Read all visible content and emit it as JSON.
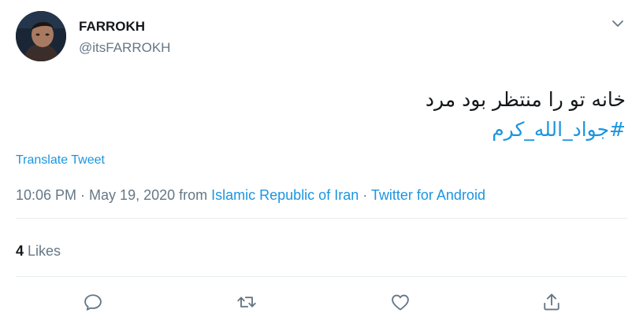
{
  "user": {
    "display_name": "FARROKH",
    "handle": "@itsFARROKH"
  },
  "tweet": {
    "text_line1": "خانه تو را منتظر بود مرد",
    "hashtag": "#جواد_الله_کرم",
    "translate_label": "Translate Tweet"
  },
  "meta": {
    "time": "10:06 PM",
    "sep1": " · ",
    "date": "May 19, 2020",
    "from_word": " from ",
    "location": "Islamic Republic of Iran",
    "sep2": " · ",
    "source": "Twitter for Android"
  },
  "stats": {
    "likes_count": "4",
    "likes_label": "Likes"
  },
  "colors": {
    "accent": "#1b95e0",
    "secondary_text": "#657786",
    "divider": "#e6ecf0"
  },
  "icons": [
    "chevron-down-icon",
    "reply-icon",
    "retweet-icon",
    "like-icon",
    "share-icon"
  ]
}
